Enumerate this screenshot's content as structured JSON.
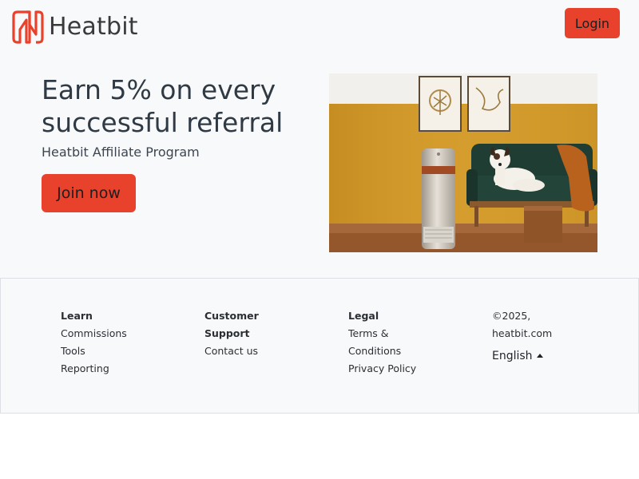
{
  "brand": {
    "name": "Heatbit",
    "accent_color": "#e8412c"
  },
  "header": {
    "login_label": "Login"
  },
  "hero": {
    "title": "Earn 5% on every successful referral",
    "subtitle": "Heatbit Affiliate Program",
    "cta_label": "Join now",
    "image": "living-room-heater-dog-illustration"
  },
  "footer": {
    "learn": {
      "heading": "Learn",
      "links": [
        "Commissions",
        "Tools",
        "Reporting"
      ]
    },
    "support": {
      "heading": "Customer Support",
      "links": [
        "Contact us"
      ]
    },
    "legal": {
      "heading": "Legal",
      "links": [
        "Terms & Conditions",
        "Privacy Policy"
      ]
    },
    "copyright": "©2025, heatbit.com",
    "language": "English"
  }
}
